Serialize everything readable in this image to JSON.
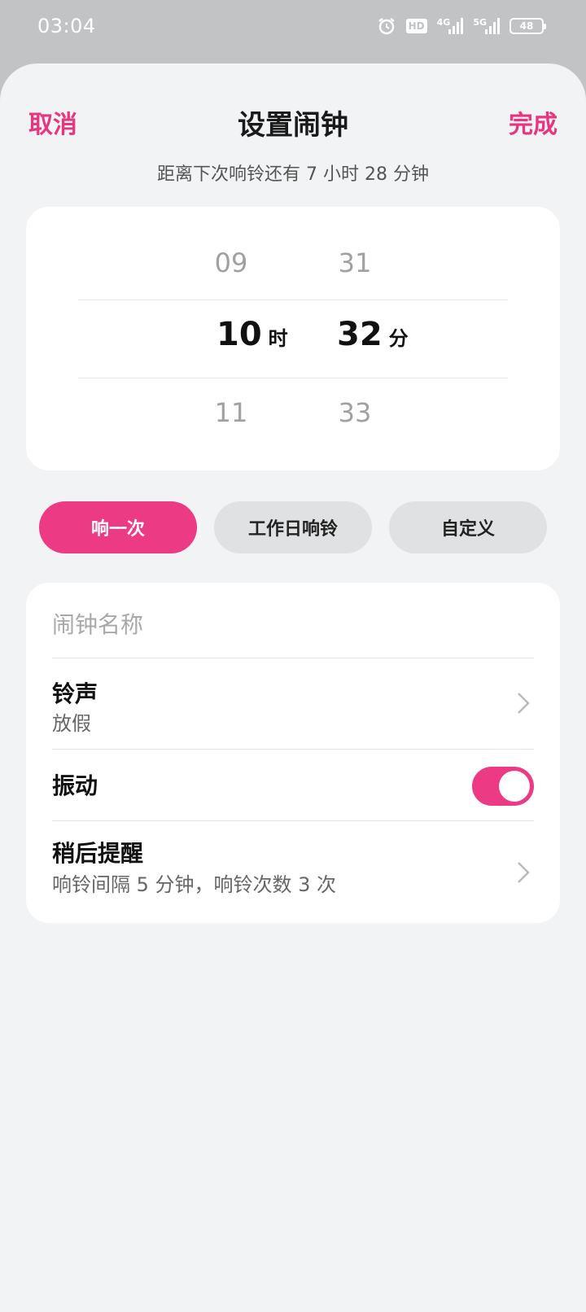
{
  "status_bar": {
    "time": "03:04",
    "icons": [
      "alarm-icon",
      "hd-icon",
      "signal-4g-icon",
      "signal-5g-icon",
      "battery-icon"
    ],
    "hd_label": "HD",
    "net_4g": "4G",
    "net_5g": "5G",
    "battery_level": "48"
  },
  "header": {
    "cancel_label": "取消",
    "title": "设置闹钟",
    "done_label": "完成",
    "subtitle": "距离下次响铃还有 7 小时 28 分钟"
  },
  "picker": {
    "hour_prev": "09",
    "hour_selected": "10",
    "hour_unit": "时",
    "hour_next": "11",
    "minute_prev": "31",
    "minute_selected": "32",
    "minute_unit": "分",
    "minute_next": "33"
  },
  "repeat_options": {
    "once": "响一次",
    "workday": "工作日响铃",
    "custom": "自定义",
    "selected": "响一次"
  },
  "settings": {
    "name_placeholder": "闹钟名称",
    "ringtone_label": "铃声",
    "ringtone_value": "放假",
    "vibration_label": "振动",
    "vibration_on": true,
    "snooze_label": "稍后提醒",
    "snooze_value": "响铃间隔 5 分钟，响铃次数 3 次"
  },
  "colors": {
    "accent": "#ec3a84",
    "sheet_bg": "#f2f3f5",
    "status_bg": "#c2c3c5"
  }
}
